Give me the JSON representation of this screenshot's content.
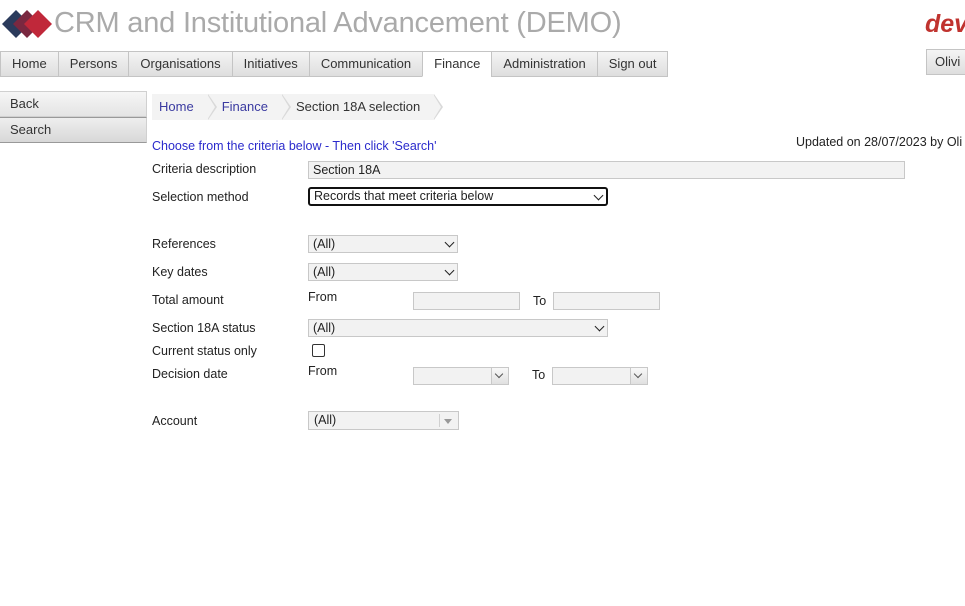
{
  "header": {
    "app_title": "CRM and Institutional Advancement (DEMO)",
    "brand": "dev",
    "user_button": "Olivi"
  },
  "nav": {
    "items": [
      "Home",
      "Persons",
      "Organisations",
      "Initiatives",
      "Communication",
      "Finance",
      "Administration",
      "Sign out"
    ],
    "active": "Finance"
  },
  "sidebar": {
    "back": "Back",
    "search": "Search"
  },
  "breadcrumb": {
    "home": "Home",
    "finance": "Finance",
    "current": "Section 18A selection"
  },
  "form": {
    "instructions": "Choose from the criteria below - Then click 'Search'",
    "updated": "Updated on 28/07/2023 by Oli",
    "criteria_description_label": "Criteria description",
    "criteria_description_value": "Section 18A",
    "selection_method_label": "Selection method",
    "selection_method_value": "Records that meet criteria below",
    "references_label": "References",
    "references_value": "(All)",
    "key_dates_label": "Key dates",
    "key_dates_value": "(All)",
    "total_amount_label": "Total amount",
    "from_label": "From",
    "to_label": "To",
    "total_from_value": "",
    "total_to_value": "",
    "status_label": "Section 18A status",
    "status_value": "(All)",
    "current_status_label": "Current status only",
    "current_status_checked": false,
    "decision_date_label": "Decision date",
    "account_label": "Account",
    "account_value": "(All)"
  },
  "colors": {
    "title_gray": "#aaaaaa",
    "brand_red": "#c0332f",
    "link_blue": "#3a3aa0",
    "instruction_blue": "#2a2acc"
  }
}
